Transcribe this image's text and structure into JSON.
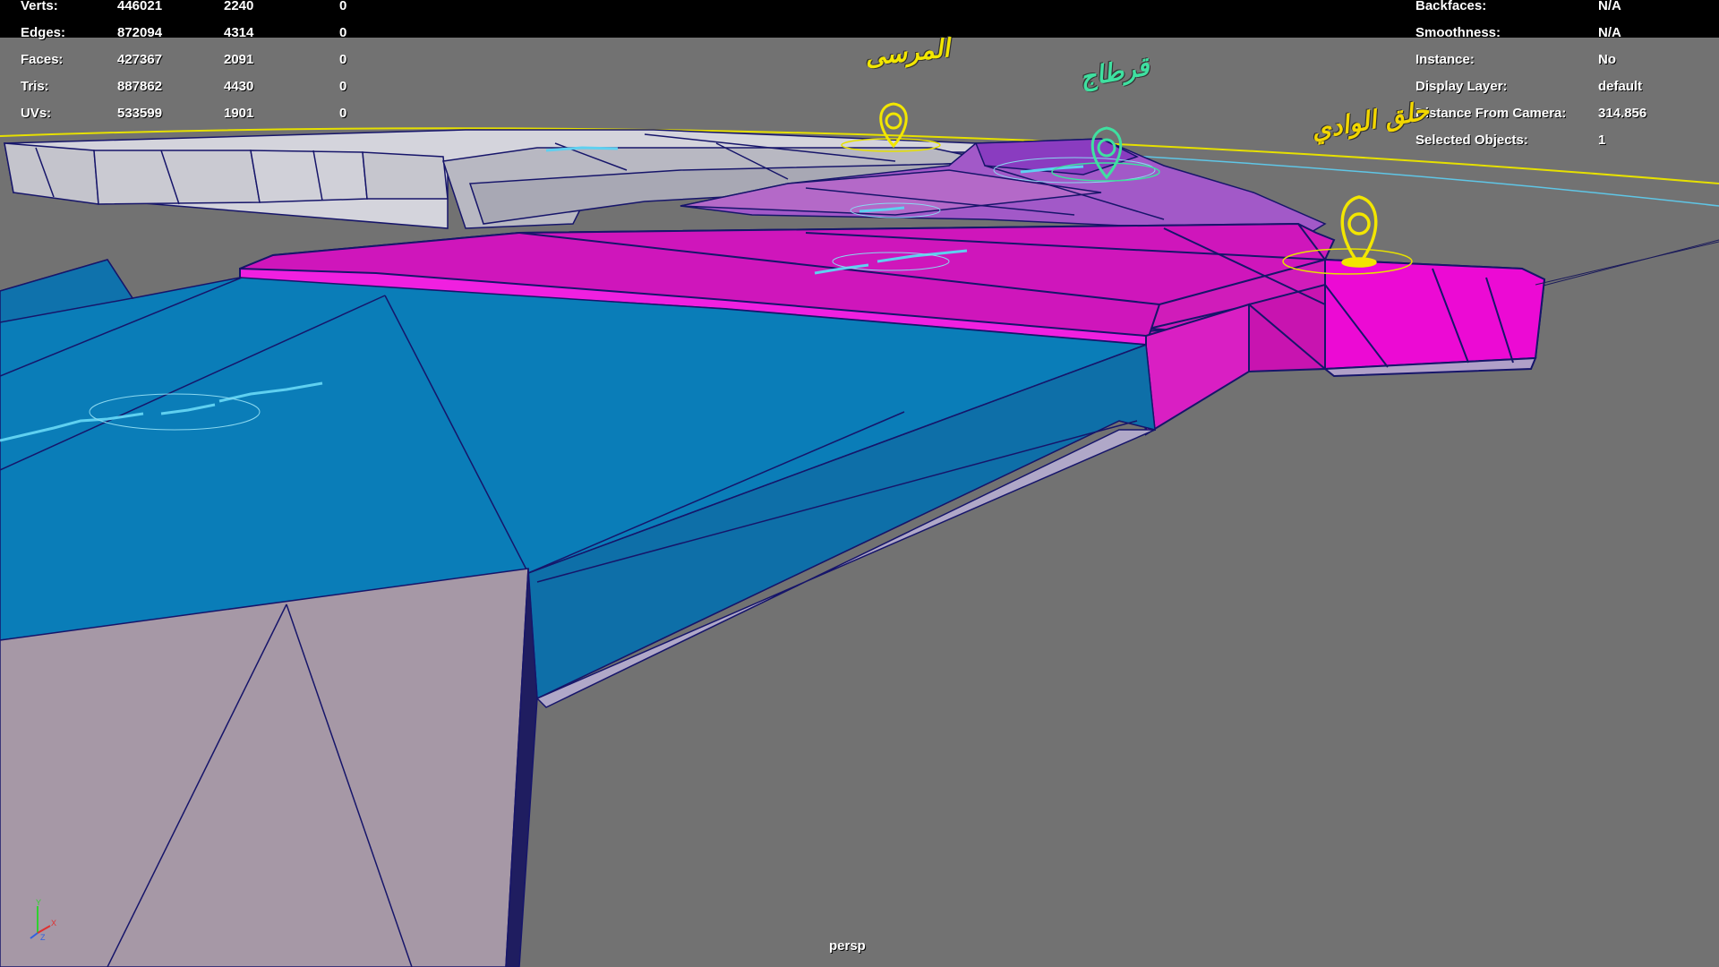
{
  "hud_stats": {
    "rows": [
      {
        "label": "Verts:",
        "values": [
          "446021",
          "2240",
          "0"
        ]
      },
      {
        "label": "Edges:",
        "values": [
          "872094",
          "4314",
          "0"
        ]
      },
      {
        "label": "Faces:",
        "values": [
          "427367",
          "2091",
          "0"
        ]
      },
      {
        "label": "Tris:",
        "values": [
          "887862",
          "4430",
          "0"
        ]
      },
      {
        "label": "UVs:",
        "values": [
          "533599",
          "1901",
          "0"
        ]
      }
    ]
  },
  "hud_info": {
    "rows": [
      {
        "label": "Backfaces:",
        "value": "N/A"
      },
      {
        "label": "Smoothness:",
        "value": "N/A"
      },
      {
        "label": "Instance:",
        "value": "No"
      },
      {
        "label": "Display Layer:",
        "value": "default"
      },
      {
        "label": "Distance From Camera:",
        "value": "314.856"
      },
      {
        "label": "Selected Objects:",
        "value": "1"
      }
    ]
  },
  "camera_name": "persp",
  "map_labels": [
    {
      "text": "المرسى",
      "color": "#f2e600"
    },
    {
      "text": "قرطاج",
      "color": "#3fe0a0"
    },
    {
      "text": "حلق الوادي",
      "color": "#f2d600"
    }
  ],
  "colors": {
    "background": "#727272",
    "blue_region": "#0a7db8",
    "magenta_region": "#e010c8",
    "grey_region": "#a6a6b2",
    "wireframe": "#16156a",
    "pin_yellow": "#f2e600",
    "pin_green": "#3fe0a0"
  },
  "icons": [
    "location-pin-icon",
    "axis-gizmo-icon"
  ]
}
